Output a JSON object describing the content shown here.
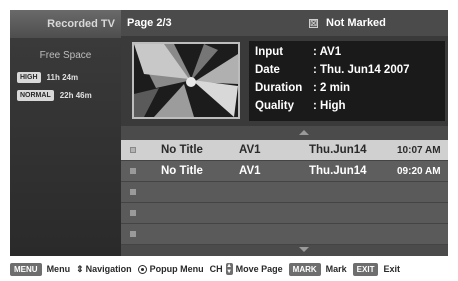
{
  "sidebar": {
    "title": "Recorded TV",
    "free_space_label": "Free Space",
    "qualities": [
      {
        "badge": "HIGH",
        "time": "11h 24m"
      },
      {
        "badge": "NORMAL",
        "time": "22h 46m"
      }
    ]
  },
  "main": {
    "page": "Page 2/3",
    "filter": "Not Marked",
    "info": {
      "input": {
        "key": "Input",
        "value": ": AV1"
      },
      "date": {
        "key": "Date",
        "value": ": Thu. Jun14 2007"
      },
      "duration": {
        "key": "Duration",
        "value": ": 2 min"
      },
      "quality": {
        "key": "Quality",
        "value": ": High"
      }
    },
    "rows": [
      {
        "title": "No Title",
        "source": "AV1",
        "date": "Thu.Jun14",
        "time": "10:07 AM"
      },
      {
        "title": "No Title",
        "source": "AV1",
        "date": "Thu.Jun14",
        "time": "09:20 AM"
      },
      {
        "title": "",
        "source": "",
        "date": "",
        "time": ""
      },
      {
        "title": "",
        "source": "",
        "date": "",
        "time": ""
      },
      {
        "title": "",
        "source": "",
        "date": "",
        "time": ""
      }
    ]
  },
  "help": {
    "menu_key": "MENU",
    "menu_label": "Menu",
    "nav_label": "Navigation",
    "popup_label": "Popup Menu",
    "ch_label": "CH",
    "move_label": "Move Page",
    "mark_key": "MARK",
    "mark_label": "Mark",
    "exit_key": "EXIT",
    "exit_label": "Exit"
  }
}
